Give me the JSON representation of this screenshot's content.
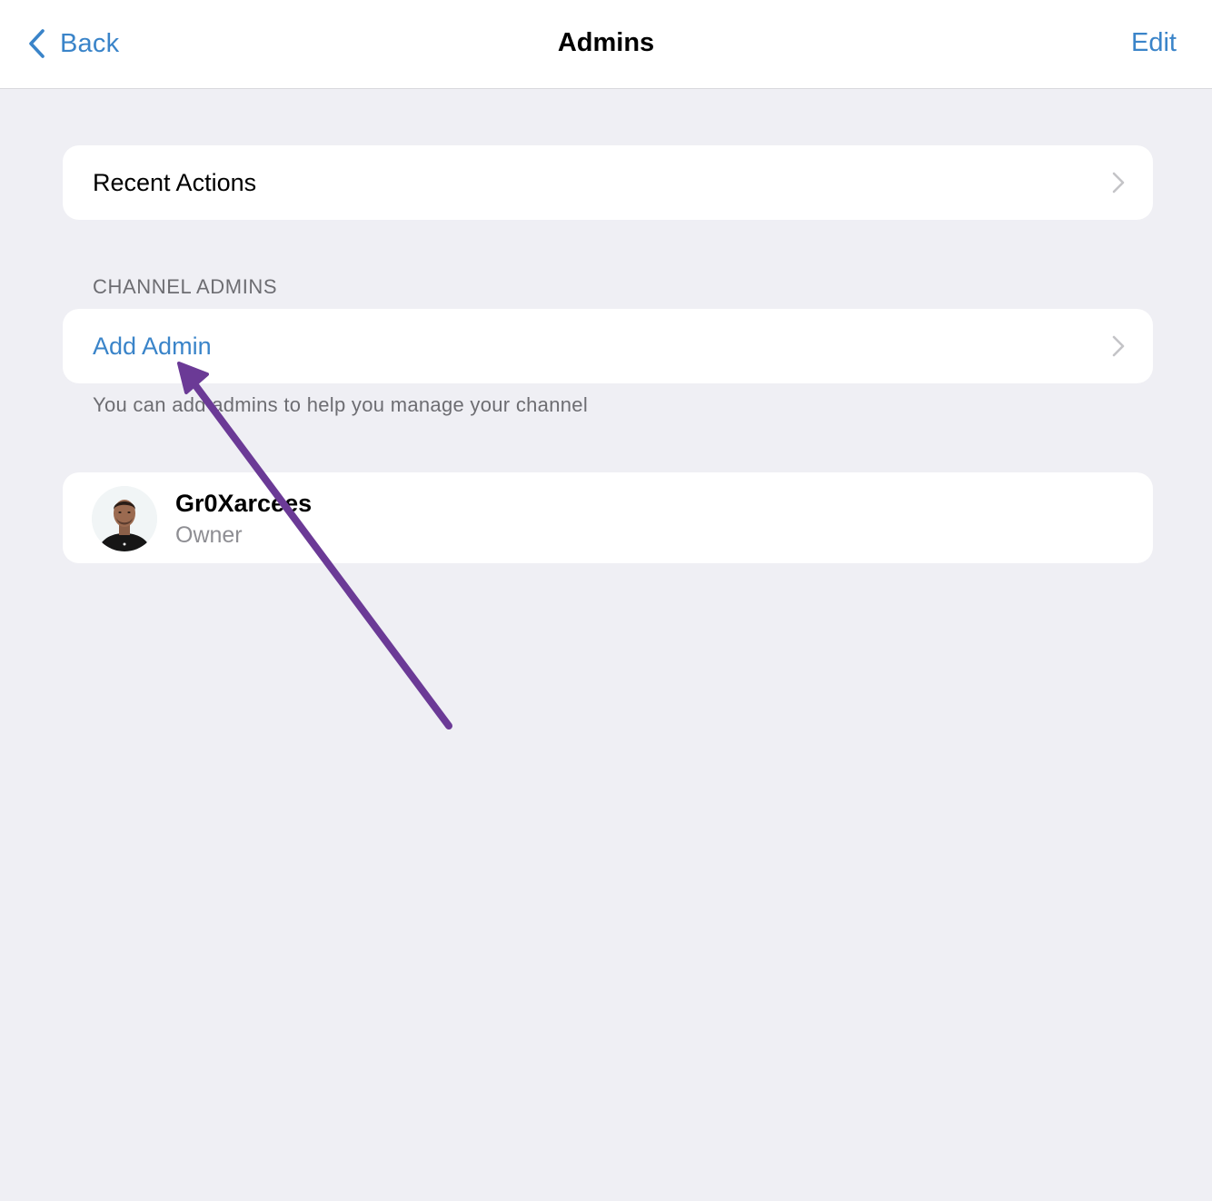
{
  "nav": {
    "back_label": "Back",
    "title": "Admins",
    "edit_label": "Edit"
  },
  "recent_actions": {
    "label": "Recent Actions"
  },
  "channel_admins": {
    "header": "CHANNEL ADMINS",
    "add_admin_label": "Add Admin",
    "footer": "You can add admins to help you manage your channel"
  },
  "admins": [
    {
      "name": "Gr0Xarcees",
      "role": "Owner"
    }
  ],
  "colors": {
    "accent": "#3a84c9",
    "background": "#efeff4",
    "annotation_arrow": "#6b3a96"
  },
  "icons": {
    "back": "chevron-left-icon",
    "disclosure": "chevron-right-icon"
  }
}
